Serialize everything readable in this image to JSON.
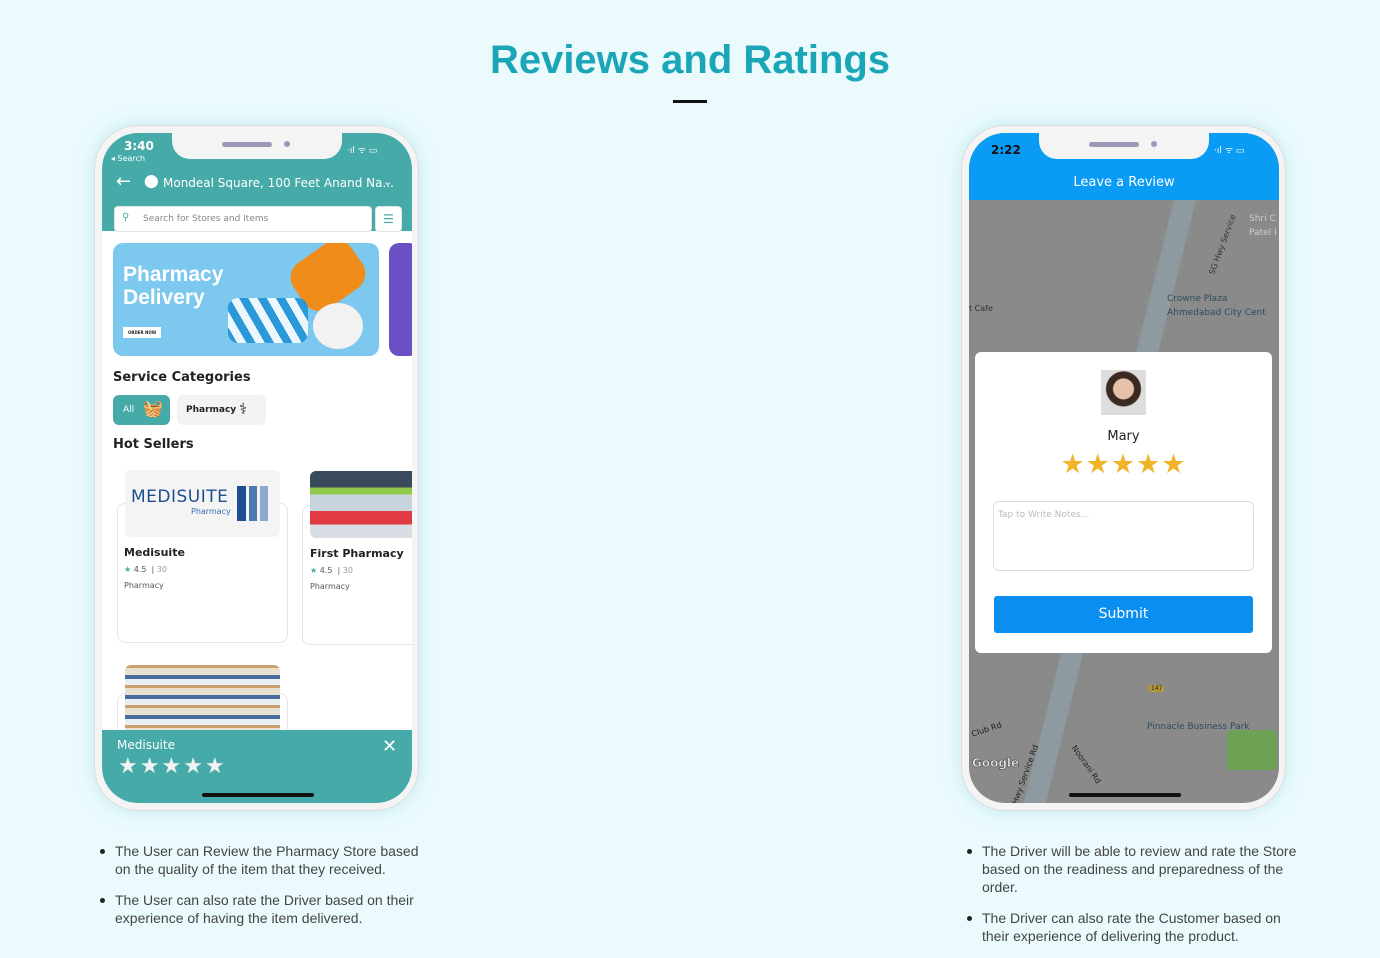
{
  "page": {
    "title": "Reviews and Ratings"
  },
  "colors": {
    "accent_title": "#1aa6b7",
    "teal": "#45aaa8",
    "blue": "#0a9cf5",
    "star": "#f0b429"
  },
  "phone_user": {
    "status": {
      "time": "3:40",
      "back_app": "◂ Search"
    },
    "header": {
      "location": "Mondeal Square, 100 Feet Anand Na..."
    },
    "search": {
      "placeholder": "Search for Stores and Items"
    },
    "banner": {
      "line1": "Pharmacy",
      "line2": "Delivery",
      "cta": "ORDER NOW"
    },
    "service_categories": {
      "heading": "Service Categories",
      "items": [
        {
          "label": "All",
          "icon": "basket-icon",
          "selected": true
        },
        {
          "label": "Pharmacy",
          "icon": "medicine-bottle-icon",
          "selected": false
        }
      ]
    },
    "hot_sellers": {
      "heading": "Hot Sellers",
      "stores": [
        {
          "name": "Medisuite",
          "rating": "4.5",
          "count": "30",
          "category": "Pharmacy",
          "logo_text": "MEDISUITE",
          "logo_sub": "Pharmacy"
        },
        {
          "name": "First Pharmacy",
          "rating": "4.5",
          "count": "30",
          "category": "Pharmacy"
        }
      ]
    },
    "rating_sheet": {
      "store": "Medisuite",
      "stars": 5,
      "rating": 0
    }
  },
  "phone_driver": {
    "status": {
      "time": "2:22"
    },
    "header": {
      "title": "Leave a Review"
    },
    "map": {
      "labels": [
        "SG Hwy Service",
        "Shri C",
        "Patel I",
        "Crowne Plaza",
        "Ahmedabad City Cent",
        "t Cafe",
        "147",
        "Club Rd",
        "Pinnacle Business Park",
        "Noorani Rd",
        "Hwy Service Rd",
        "Google"
      ]
    },
    "review": {
      "name": "Mary",
      "rating": 5,
      "notes_placeholder": "Tap to Write Notes...",
      "submit": "Submit"
    }
  },
  "bullets_left": [
    "The User can Review the Pharmacy Store based on the quality of the item that they received.",
    "The User can also rate the Driver based on their experience of having the item delivered."
  ],
  "bullets_right": [
    "The Driver will be able to review and rate the Store based on the readiness and preparedness of the order.",
    "The Driver can also rate the Customer based on their experience of delivering the product."
  ]
}
